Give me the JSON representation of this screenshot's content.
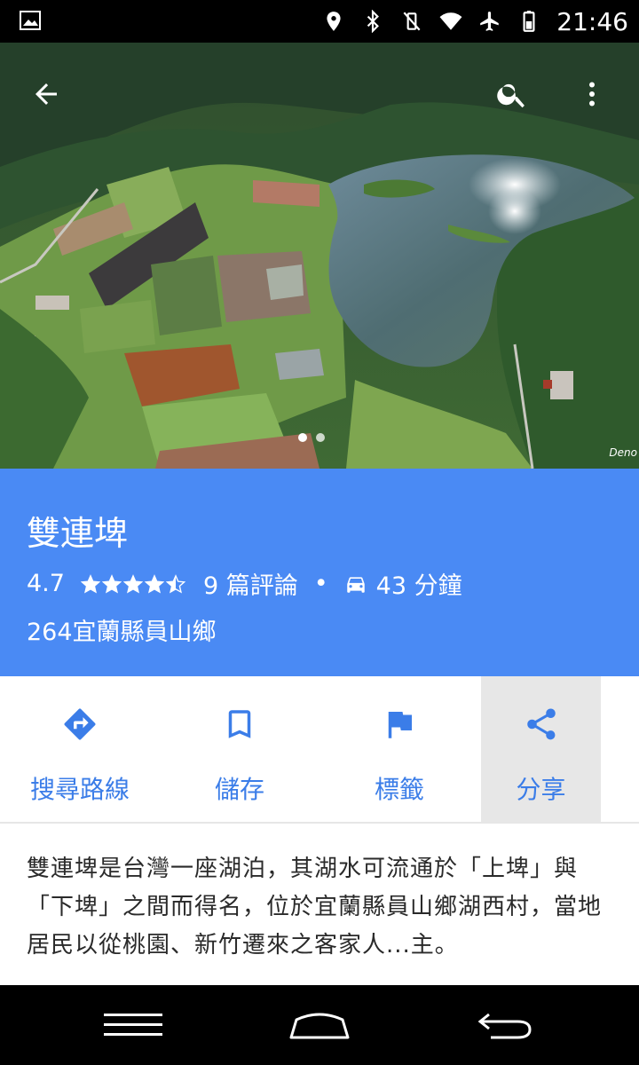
{
  "status_bar": {
    "time": "21:46",
    "icons": [
      "gallery-icon",
      "location-icon",
      "bluetooth-icon",
      "vibrate-off-icon",
      "wifi-icon",
      "airplane-icon",
      "battery-icon"
    ]
  },
  "hero": {
    "credit": "Deno",
    "page_count": 2,
    "active_page": 1,
    "top_icons": [
      "back-arrow-icon",
      "search-icon",
      "more-vert-icon"
    ]
  },
  "place": {
    "name": "雙連埤",
    "rating": "4.7",
    "rating_value": 4.7,
    "rating_max": 5,
    "reviews": "9 篇評論",
    "separator": "•",
    "drive_time": "43 分鐘",
    "address": "264宜蘭縣員山鄉"
  },
  "actions": [
    {
      "label": "搜尋路線",
      "icon": "directions-icon"
    },
    {
      "label": "儲存",
      "icon": "bookmark-icon"
    },
    {
      "label": "標籤",
      "icon": "flag-icon"
    },
    {
      "label": "分享",
      "icon": "share-icon"
    }
  ],
  "description": "雙連埤是台灣一座湖泊，其湖水可流通於「上埤」與「下埤」之間而得名，位於宜蘭縣員山鄉湖西村，當地居民以從桃園、新竹遷來之客家人...主。",
  "colors": {
    "header_bg": "#4a8af4",
    "accent": "#3b7de8",
    "highlight_bg": "#e7e7e7"
  }
}
